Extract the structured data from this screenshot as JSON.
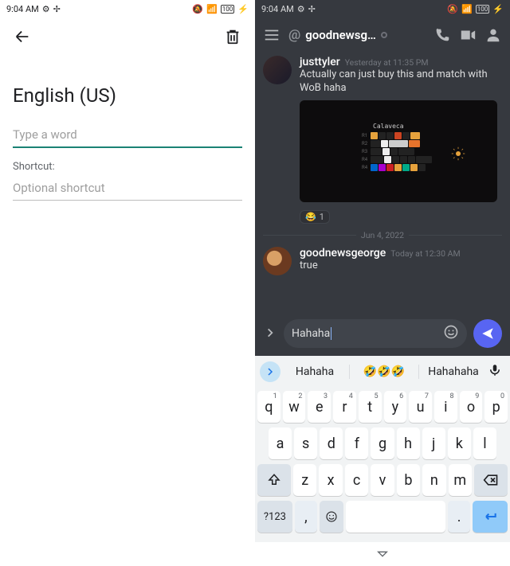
{
  "status": {
    "time": "9:04 AM",
    "gear": "⚙",
    "ast": "✢",
    "bell": "🔕",
    "wifi": "📶",
    "batt": "100"
  },
  "left": {
    "title": "English (US)",
    "word_placeholder": "Type a word",
    "shortcut_label": "Shortcut:",
    "shortcut_placeholder": "Optional shortcut"
  },
  "discord": {
    "channel": "goodnewsg…",
    "messages": [
      {
        "user": "justtyler",
        "ts": "Yesterday at 11:35 PM",
        "text": "Actually can just buy this and match with WoB haha",
        "attachment_title": "Calaveca",
        "rows": [
          "R1",
          "R2",
          "R3",
          "R4",
          "R4"
        ]
      },
      {
        "user": "goodnewsgeorge",
        "ts": "Today at 12:30 AM",
        "text": "true"
      }
    ],
    "reaction": {
      "emoji": "😂",
      "count": "1"
    },
    "divider": "Jun 4, 2022",
    "compose_text": "Hahaha"
  },
  "keyboard": {
    "suggestions": [
      "Hahaha",
      "🤣🤣🤣",
      "Hahahaha"
    ],
    "rows": {
      "r1": [
        [
          "q",
          "1"
        ],
        [
          "w",
          "2"
        ],
        [
          "e",
          "3"
        ],
        [
          "r",
          "4"
        ],
        [
          "t",
          "5"
        ],
        [
          "y",
          "6"
        ],
        [
          "u",
          "7"
        ],
        [
          "i",
          "8"
        ],
        [
          "o",
          "9"
        ],
        [
          "p",
          "0"
        ]
      ],
      "r2": [
        "a",
        "s",
        "d",
        "f",
        "g",
        "h",
        "j",
        "k",
        "l"
      ],
      "r3": [
        "z",
        "x",
        "c",
        "v",
        "b",
        "n",
        "m"
      ],
      "r4": {
        "sym": "?123",
        "comma": ",",
        "period": "."
      }
    }
  }
}
